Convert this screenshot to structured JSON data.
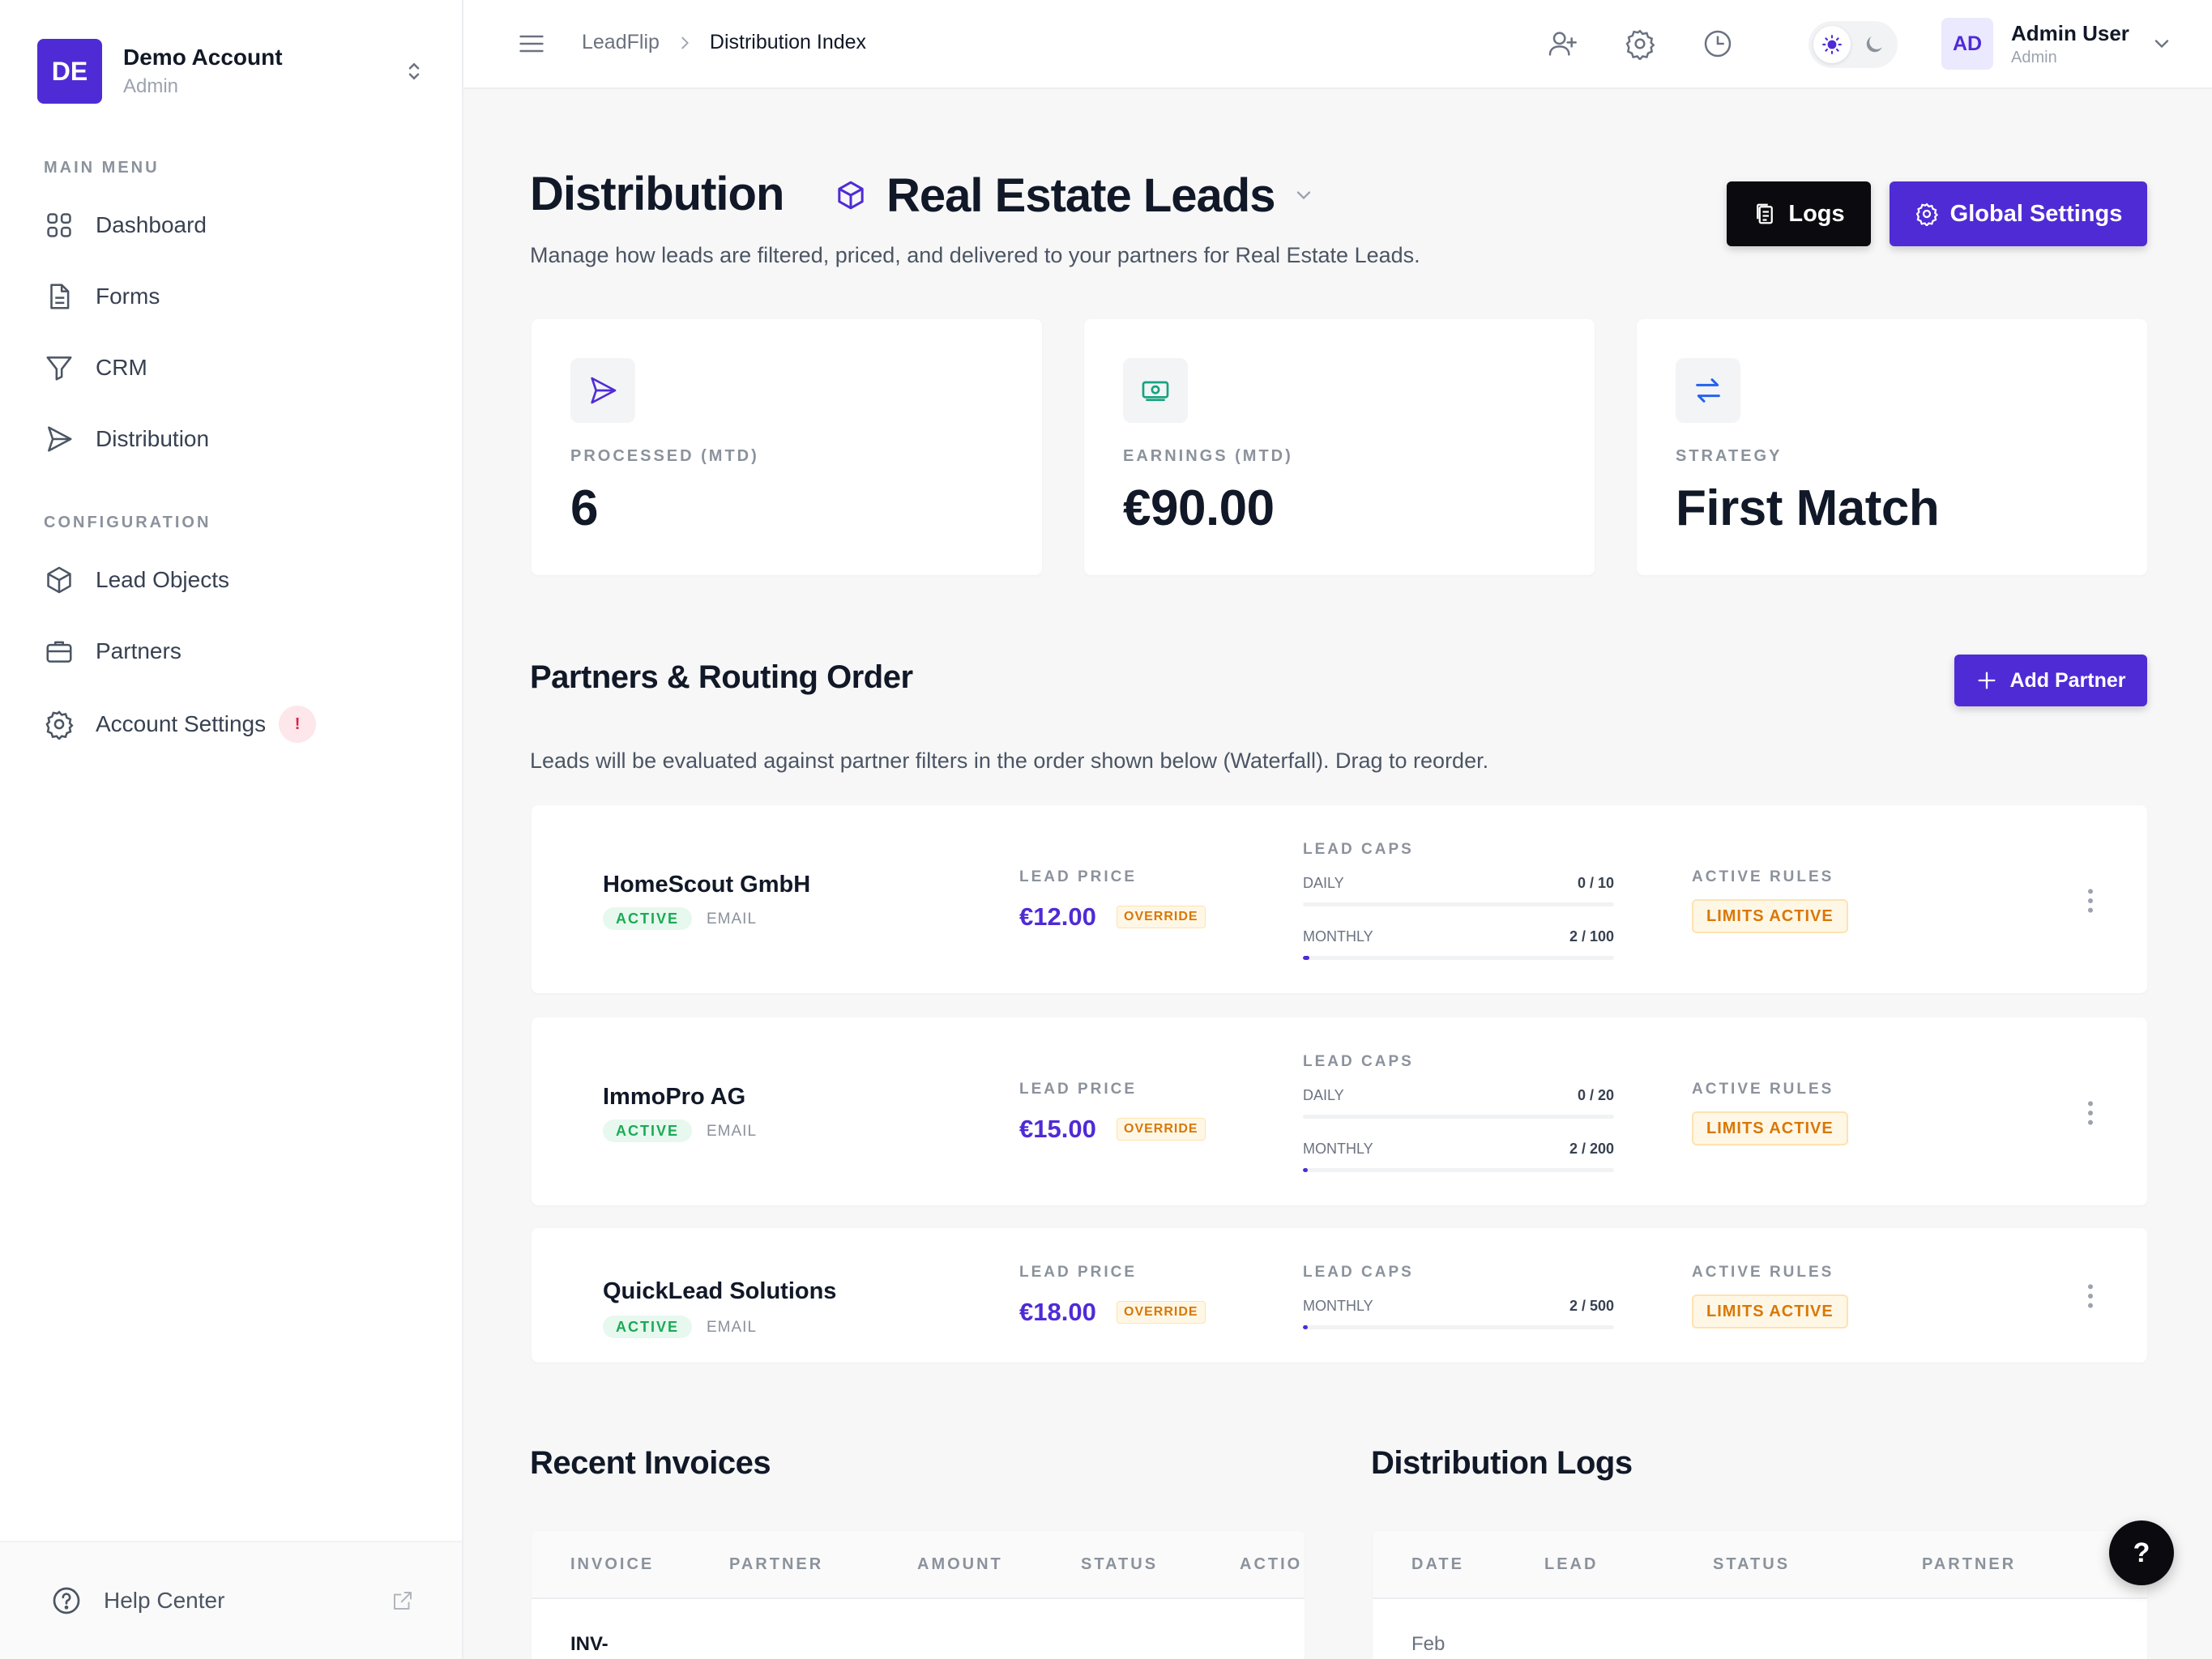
{
  "account": {
    "initials": "DE",
    "name": "Demo Account",
    "role": "Admin"
  },
  "sidebar": {
    "main_menu_title": "MAIN MENU",
    "main_menu": [
      {
        "label": "Dashboard",
        "icon": "grid-icon"
      },
      {
        "label": "Forms",
        "icon": "document-icon"
      },
      {
        "label": "CRM",
        "icon": "filter-icon"
      },
      {
        "label": "Distribution",
        "icon": "send-icon"
      }
    ],
    "configuration_title": "CONFIGURATION",
    "configuration": [
      {
        "label": "Lead Objects",
        "icon": "cube-icon"
      },
      {
        "label": "Partners",
        "icon": "briefcase-icon"
      },
      {
        "label": "Account Settings",
        "icon": "gear-icon",
        "badge": "!"
      }
    ],
    "help_label": "Help Center"
  },
  "topbar": {
    "breadcrumb_root": "LeadFlip",
    "breadcrumb_current": "Distribution Index",
    "user_initials": "AD",
    "user_name": "Admin User",
    "user_role": "Admin"
  },
  "header": {
    "title": "Distribution",
    "object_name": "Real Estate Leads",
    "subtitle": "Manage how leads are filtered, priced, and delivered to your partners for Real Estate Leads.",
    "logs_button": "Logs",
    "global_settings_button": "Global Settings"
  },
  "stats": [
    {
      "label": "PROCESSED (MTD)",
      "value": "6",
      "icon": "send-icon"
    },
    {
      "label": "EARNINGS (MTD)",
      "value": "€90.00",
      "icon": "cash-icon"
    },
    {
      "label": "STRATEGY",
      "value": "First Match",
      "icon": "arrows-swap-icon"
    }
  ],
  "partners_section": {
    "title": "Partners & Routing Order",
    "add_button": "Add Partner",
    "description": "Leads will be evaluated against partner filters in the order shown below (Waterfall). Drag to reorder.",
    "labels": {
      "lead_price": "LEAD PRICE",
      "lead_caps": "LEAD CAPS",
      "active_rules": "ACTIVE RULES",
      "override": "OVERRIDE",
      "limits_active": "LIMITS ACTIVE",
      "daily": "DAILY",
      "monthly": "MONTHLY"
    },
    "partners": [
      {
        "name": "HomeScout GmbH",
        "status": "ACTIVE",
        "channel": "EMAIL",
        "price": "€12.00",
        "caps": [
          {
            "name": "DAILY",
            "value": "0 / 10",
            "fraction": 0.0
          },
          {
            "name": "MONTHLY",
            "value": "2 / 100",
            "fraction": 0.02
          }
        ]
      },
      {
        "name": "ImmoPro AG",
        "status": "ACTIVE",
        "channel": "EMAIL",
        "price": "€15.00",
        "caps": [
          {
            "name": "DAILY",
            "value": "0 / 20",
            "fraction": 0.0
          },
          {
            "name": "MONTHLY",
            "value": "2 / 200",
            "fraction": 0.01
          }
        ]
      },
      {
        "name": "QuickLead Solutions",
        "status": "ACTIVE",
        "channel": "EMAIL",
        "price": "€18.00",
        "caps": [
          {
            "name": "MONTHLY",
            "value": "2 / 500",
            "fraction": 0.004
          }
        ]
      }
    ]
  },
  "invoices": {
    "title": "Recent Invoices",
    "columns": [
      "INVOICE",
      "PARTNER",
      "AMOUNT",
      "STATUS",
      "ACTIO"
    ],
    "first_cell": "INV-"
  },
  "dist_logs": {
    "title": "Distribution Logs",
    "columns": [
      "DATE",
      "LEAD",
      "STATUS",
      "PARTNER"
    ],
    "first_cell": "Feb"
  },
  "help_fab": "?",
  "colors": {
    "primary": "#4f2bd6",
    "success": "#1aaa55",
    "warning": "#d97706",
    "dark": "#0b0b0f"
  }
}
